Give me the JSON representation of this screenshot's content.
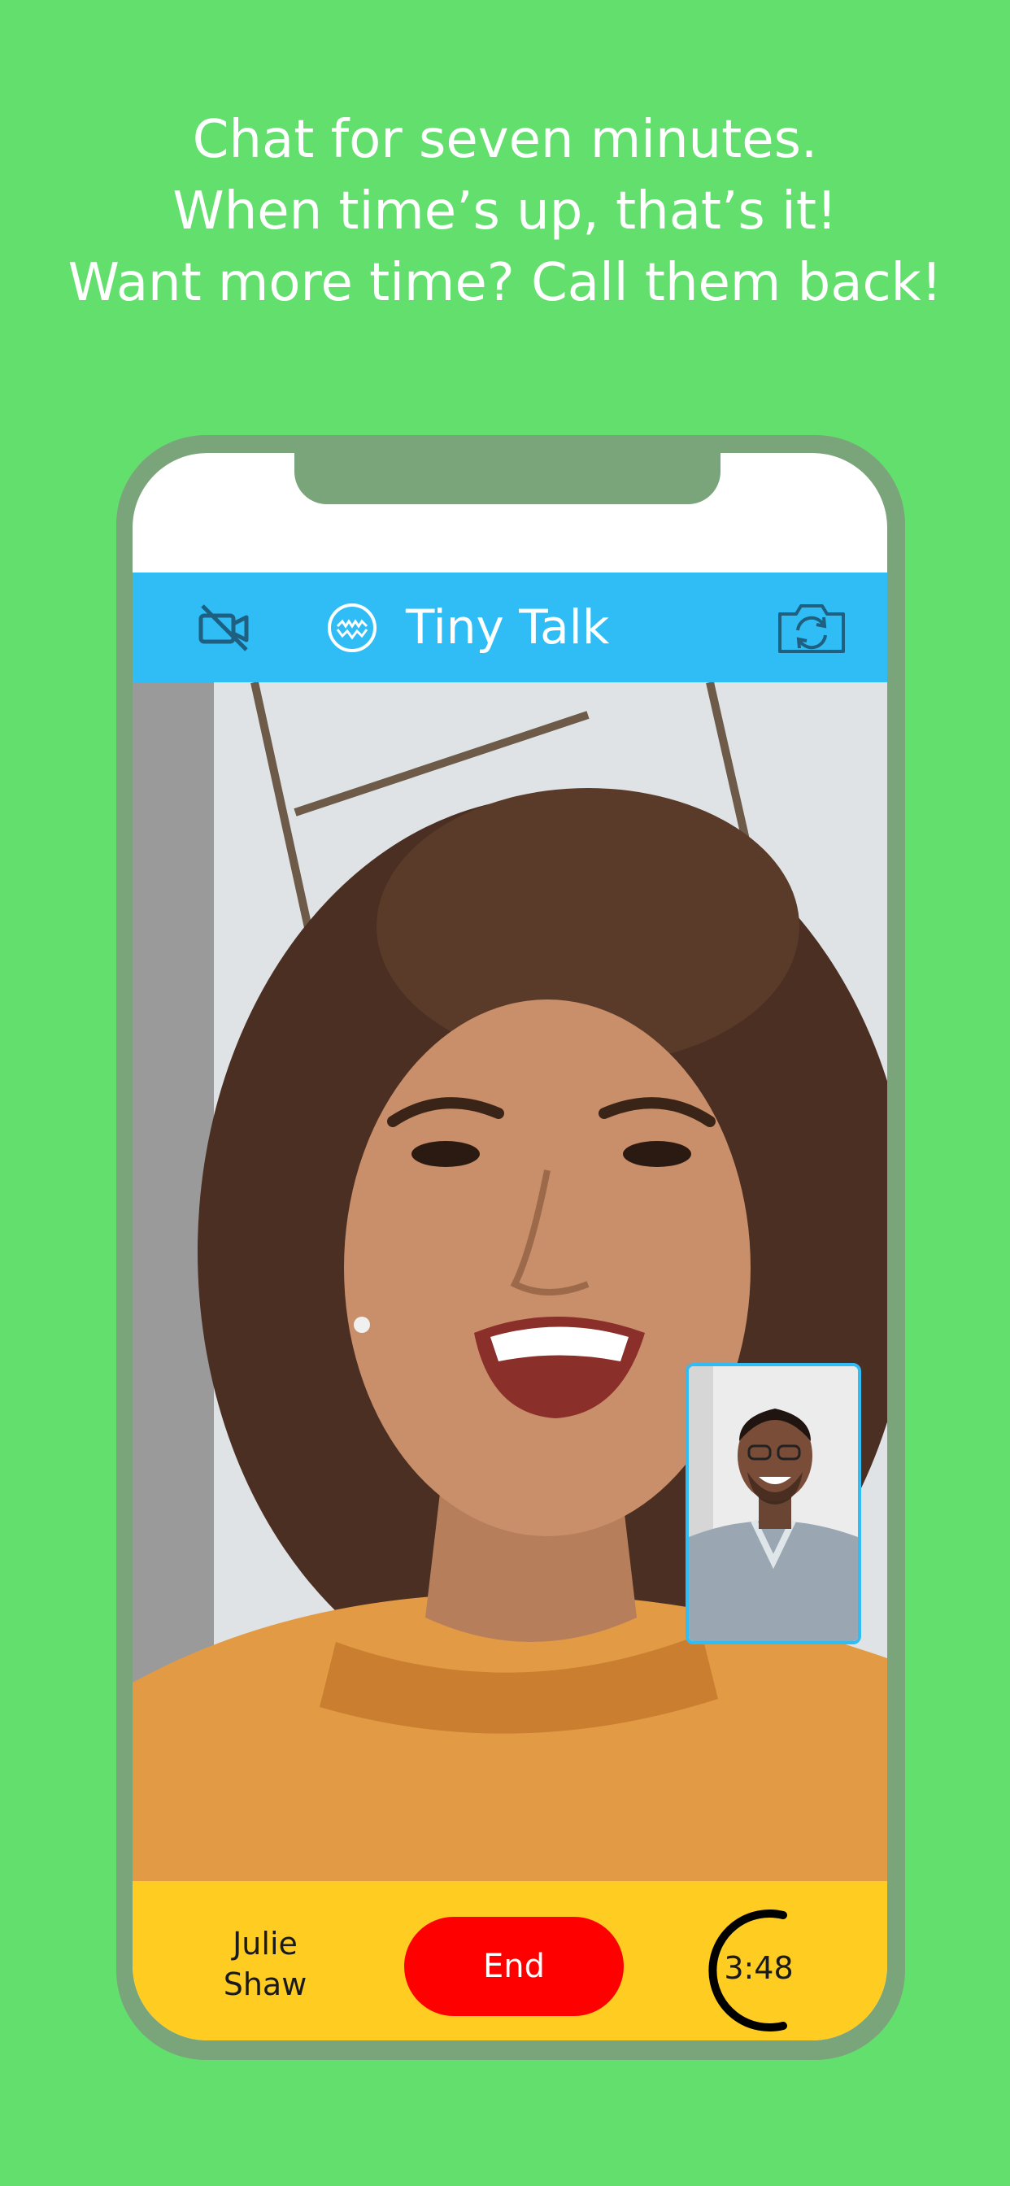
{
  "headline": {
    "line1": "Chat for seven minutes.",
    "line2": "When time’s up, that’s it!",
    "line3": "Want more time? Call them back!"
  },
  "app": {
    "title": "Tiny Talk",
    "icons": {
      "left": "video-off-icon",
      "logo": "tiny-talk-logo-icon",
      "right": "camera-flip-icon"
    }
  },
  "call": {
    "caller_first": "Julie",
    "caller_last": "Shaw",
    "end_label": "End",
    "timer": "3:48"
  },
  "colors": {
    "background": "#63df6e",
    "phone_frame": "#7aa57b",
    "app_bar": "#30bdf6",
    "bottom_bar": "#ffcc22",
    "end_button": "#ff0000"
  }
}
